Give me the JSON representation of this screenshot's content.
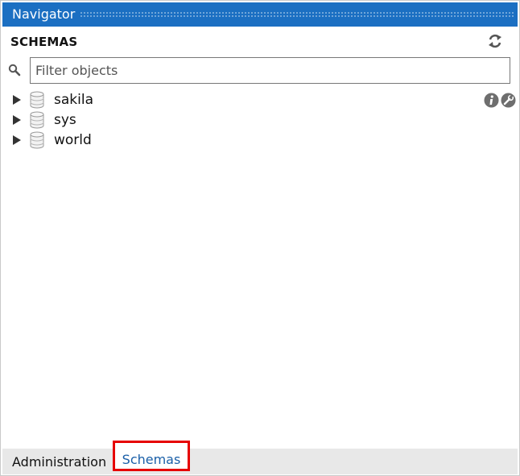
{
  "titlebar": {
    "title": "Navigator"
  },
  "section": {
    "header": "SCHEMAS"
  },
  "filter": {
    "placeholder": "Filter objects",
    "value": ""
  },
  "tree": {
    "items": [
      {
        "label": "sakila",
        "icon": "database-icon",
        "expanded": false,
        "selected_actions": true
      },
      {
        "label": "sys",
        "icon": "database-icon",
        "expanded": false
      },
      {
        "label": "world",
        "icon": "database-icon",
        "expanded": false
      }
    ]
  },
  "tabs": [
    {
      "label": "Administration",
      "active": false
    },
    {
      "label": "Schemas",
      "active": true
    }
  ],
  "colors": {
    "titlebar": "#1b6fc2",
    "highlight_box": "#e60000",
    "active_tab_text": "#1a5fa8"
  }
}
